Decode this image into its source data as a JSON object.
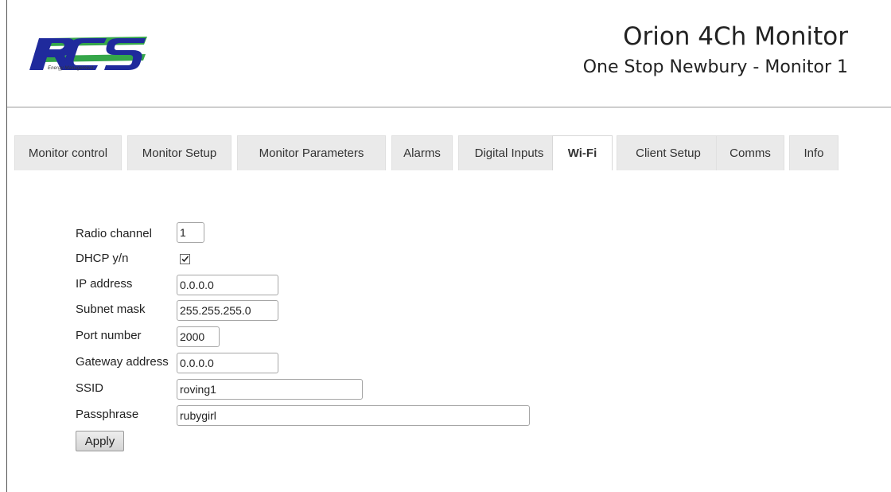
{
  "header": {
    "logo_text": "RCS",
    "logo_subtitle": "Energy Management",
    "app_title": "Orion 4Ch Monitor",
    "site_title": "One Stop Newbury - Monitor 1"
  },
  "tabs": [
    {
      "label": "Monitor control",
      "active": false
    },
    {
      "label": "Monitor Setup",
      "active": false
    },
    {
      "label": "Monitor Parameters",
      "active": false
    },
    {
      "label": "Alarms",
      "active": false
    },
    {
      "label": "Digital Inputs",
      "active": false
    },
    {
      "label": "Wi-Fi",
      "active": true
    },
    {
      "label": "Client Setup",
      "active": false
    },
    {
      "label": "Comms",
      "active": false
    },
    {
      "label": "Info",
      "active": false
    }
  ],
  "form": {
    "radio_channel": {
      "label": "Radio channel",
      "value": "1"
    },
    "dhcp": {
      "label": "DHCP y/n",
      "checked": true
    },
    "ip_address": {
      "label": "IP address",
      "value": "0.0.0.0"
    },
    "subnet_mask": {
      "label": "Subnet mask",
      "value": "255.255.255.0"
    },
    "port_number": {
      "label": "Port number",
      "value": "2000"
    },
    "gateway_address": {
      "label": "Gateway address",
      "value": "0.0.0.0"
    },
    "ssid": {
      "label": "SSID",
      "value": "roving1"
    },
    "passphrase": {
      "label": "Passphrase",
      "value": "rubygirl"
    },
    "apply_label": "Apply"
  },
  "colors": {
    "logo_blue": "#1f2a9c",
    "logo_green": "#35a64a",
    "active_tab_bg": "#ffffff",
    "tab_bg": "#eaeaea"
  }
}
